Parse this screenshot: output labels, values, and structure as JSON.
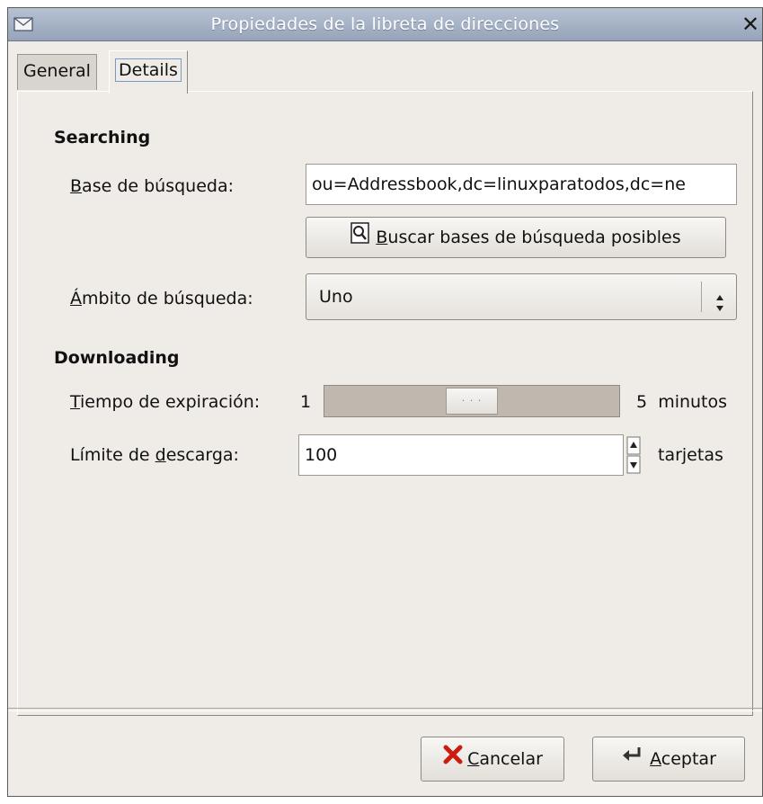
{
  "window": {
    "title": "Propiedades de la libreta de direcciones",
    "close_label": "✕"
  },
  "tabs": [
    {
      "label": "General",
      "active": false
    },
    {
      "label": "Details",
      "active": true
    }
  ],
  "searching": {
    "heading": "Searching",
    "base_label_mnemonic": "B",
    "base_label_rest": "ase de búsqueda:",
    "base_value": "ou=Addressbook,dc=linuxparatodos,dc=ne",
    "find_button_mnemonic": "B",
    "find_button_rest": "uscar bases de búsqueda posibles",
    "scope_label_mnemonic": "Á",
    "scope_label_rest": "mbito de búsqueda:",
    "scope_value": "Uno"
  },
  "downloading": {
    "heading": "Downloading",
    "timeout_label_mnemonic": "T",
    "timeout_label_rest": "iempo de expiración:",
    "timeout_min": "1",
    "timeout_max": "5",
    "timeout_unit": "minutos",
    "timeout_position_fraction": 0.5,
    "limit_label_pre": "Límite de ",
    "limit_label_mnemonic": "d",
    "limit_label_rest": "escarga:",
    "limit_value": "100",
    "limit_unit": "tarjetas"
  },
  "buttons": {
    "cancel_mnemonic": "C",
    "cancel_rest": "ancelar",
    "ok_mnemonic": "A",
    "ok_rest": "ceptar"
  },
  "colors": {
    "titlebar": "#a7b3c7",
    "window_bg": "#efebe7",
    "cancel_icon": "#cc1c10"
  }
}
